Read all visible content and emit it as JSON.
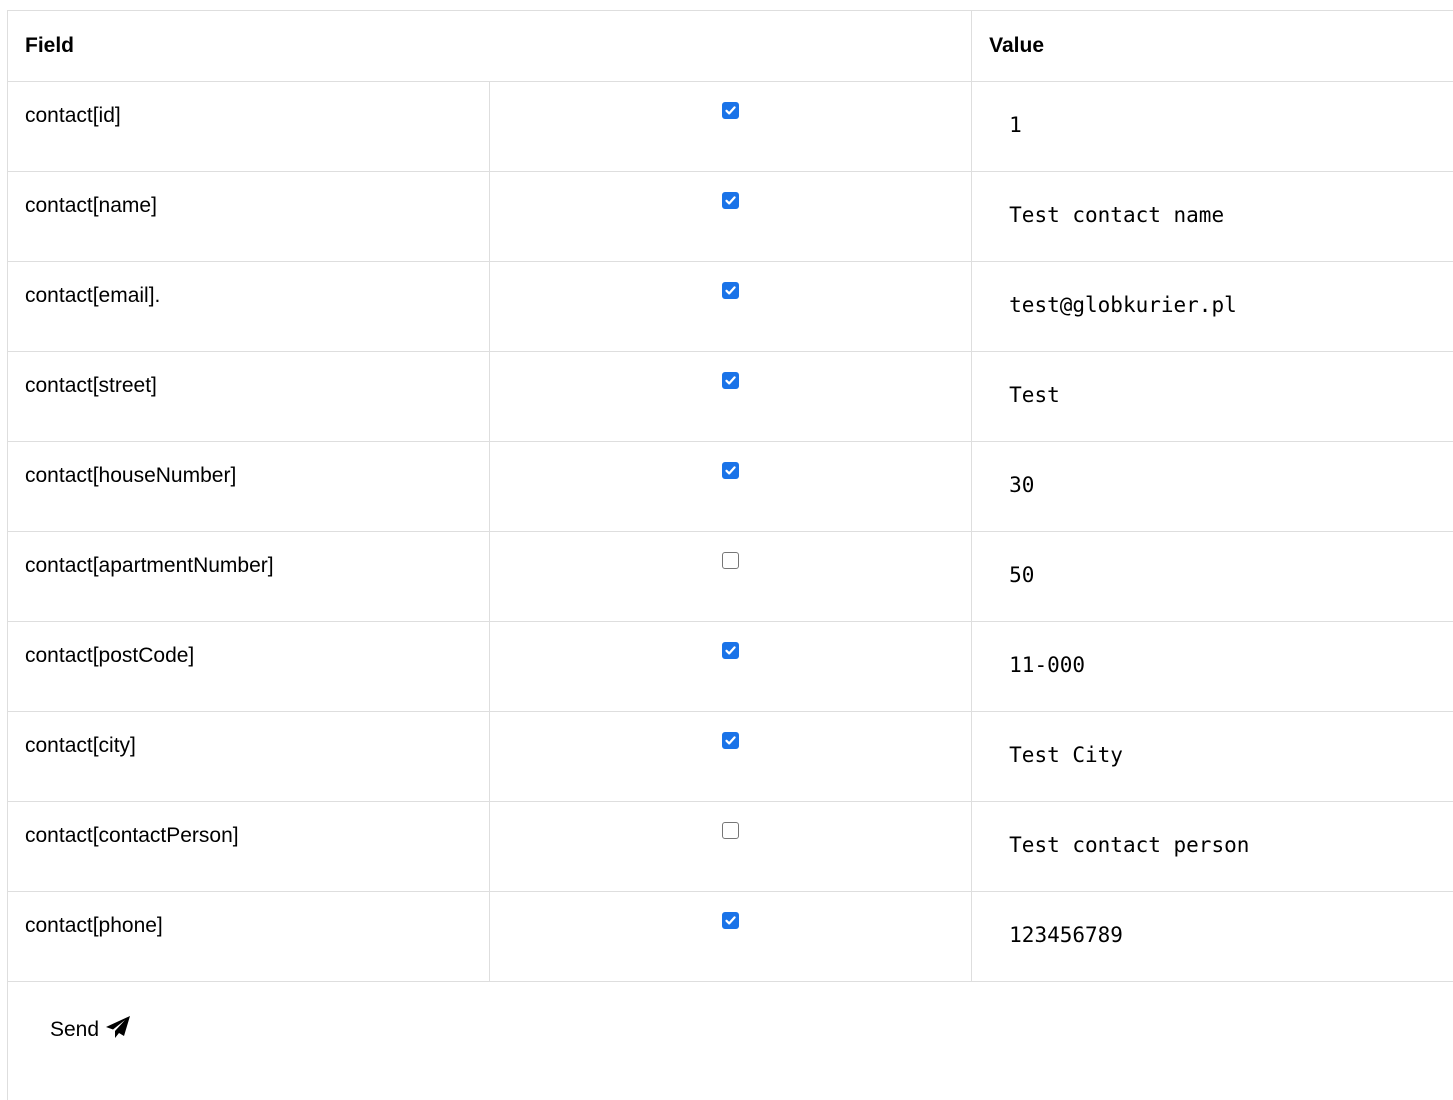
{
  "table": {
    "headers": {
      "field": "Field",
      "value": "Value"
    },
    "rows": [
      {
        "field": "contact[id]",
        "checked": true,
        "value": "1"
      },
      {
        "field": "contact[name]",
        "checked": true,
        "value": "Test contact name"
      },
      {
        "field": "contact[email].",
        "checked": true,
        "value": "test@globkurier.pl"
      },
      {
        "field": "contact[street]",
        "checked": true,
        "value": "Test"
      },
      {
        "field": "contact[houseNumber]",
        "checked": true,
        "value": "30"
      },
      {
        "field": "contact[apartmentNumber]",
        "checked": false,
        "value": "50"
      },
      {
        "field": "contact[postCode]",
        "checked": true,
        "value": "11-000"
      },
      {
        "field": "contact[city]",
        "checked": true,
        "value": "Test City"
      },
      {
        "field": "contact[contactPerson]",
        "checked": false,
        "value": "Test contact person"
      },
      {
        "field": "contact[phone]",
        "checked": true,
        "value": "123456789"
      }
    ]
  },
  "send": {
    "label": "Send",
    "icon": "paper-plane-icon"
  },
  "colors": {
    "checkbox_checked": "#1a73e8",
    "border": "#dedede"
  }
}
